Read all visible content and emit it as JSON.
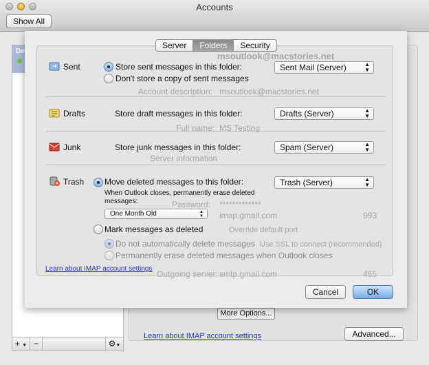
{
  "window": {
    "title": "Accounts",
    "show_all": "Show All"
  },
  "account_list": {
    "selected_label": "De",
    "add": "+",
    "remove": "−",
    "gear": "⚙"
  },
  "background_panel": {
    "email": "msoutlook@macstories.net",
    "account_description_label": "Account description:",
    "account_description": "msoutlook@macstories.net",
    "full_name_label": "Full name:",
    "full_name": "MS Testing",
    "server_info": "Server information",
    "password_label": "Password:",
    "password": "*************",
    "incoming": "imap.gmail.com",
    "incoming_port": "993",
    "override_port": "Override default port",
    "use_ssl": "Use SSL to connect (recommended)",
    "outgoing_label": "Outgoing server:",
    "outgoing": "smtp.gmail.com",
    "outgoing_port": "465",
    "more_options": "More Options...",
    "learn_link": "Learn about IMAP account settings",
    "advanced": "Advanced..."
  },
  "sheet": {
    "tabs": [
      {
        "label": "Server"
      },
      {
        "label": "Folders",
        "active": true
      },
      {
        "label": "Security"
      }
    ],
    "sent": {
      "label": "Sent",
      "opt1": "Store sent messages in this folder:",
      "opt2": "Don't store a copy of sent messages",
      "folder": "Sent Mail (Server)",
      "selected": "opt1"
    },
    "drafts": {
      "label": "Drafts",
      "text": "Store draft messages in this folder:",
      "folder": "Drafts (Server)"
    },
    "junk": {
      "label": "Junk",
      "text": "Store junk messages in this folder:",
      "folder": "Spam (Server)"
    },
    "trash": {
      "label": "Trash",
      "opt1": "Move deleted messages to this folder:",
      "folder": "Trash (Server)",
      "erase_note": "When Outlook closes, permanently erase deleted messages:",
      "erase_age": "One Month Old",
      "opt2": "Mark messages as deleted",
      "sub1": "Do not automatically delete messages",
      "sub2": "Permanently erase deleted messages when Outlook closes",
      "selected": "opt1"
    },
    "learn_link": "Learn about IMAP account settings",
    "cancel": "Cancel",
    "ok": "OK"
  },
  "colors": {
    "accent": "#8fb3e4",
    "link": "#2430d8"
  }
}
